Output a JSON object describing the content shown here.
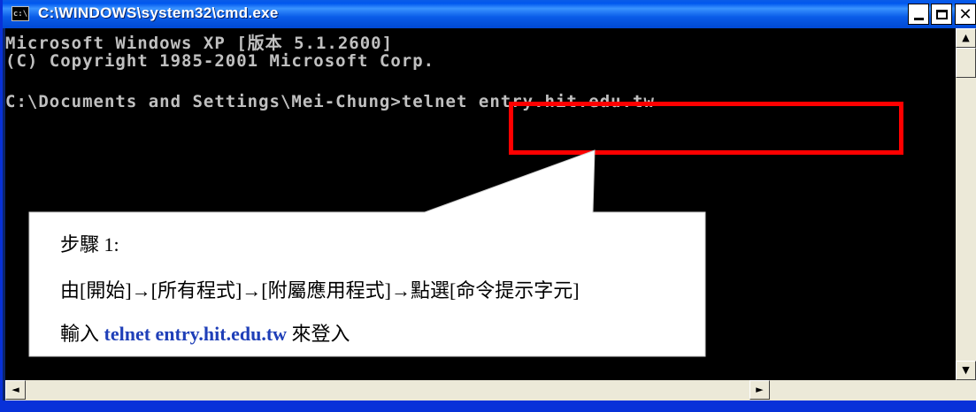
{
  "window": {
    "title": "C:\\WINDOWS\\system32\\cmd.exe",
    "icon_label": "c:\\",
    "controls": {
      "minimize": "_",
      "maximize": "□",
      "close": "✕"
    }
  },
  "console": {
    "lines": [
      "Microsoft Windows XP [版本 5.1.2600]",
      "(C) Copyright 1985-2001 Microsoft Corp.",
      "C:\\Documents and Settings\\Mei-Chung>telnet entry.hit.edu.tw"
    ]
  },
  "callout": {
    "step": "步驟 1:",
    "instruction": "由[開始]→[所有程式]→[附屬應用程式]→點選[命令提示字元]",
    "input_prefix": "輸入 ",
    "command": "telnet entry.hit.edu.tw",
    "input_suffix": " 來登入"
  },
  "scrollbar": {
    "up": "▲",
    "down": "▼",
    "left": "◄",
    "right": "►"
  },
  "colors": {
    "console_bg": "#000000",
    "console_text": "#c0c0c0",
    "highlight": "#ff0000",
    "command_text": "#1f3fb8",
    "titlebar": "#0a5ce8"
  }
}
